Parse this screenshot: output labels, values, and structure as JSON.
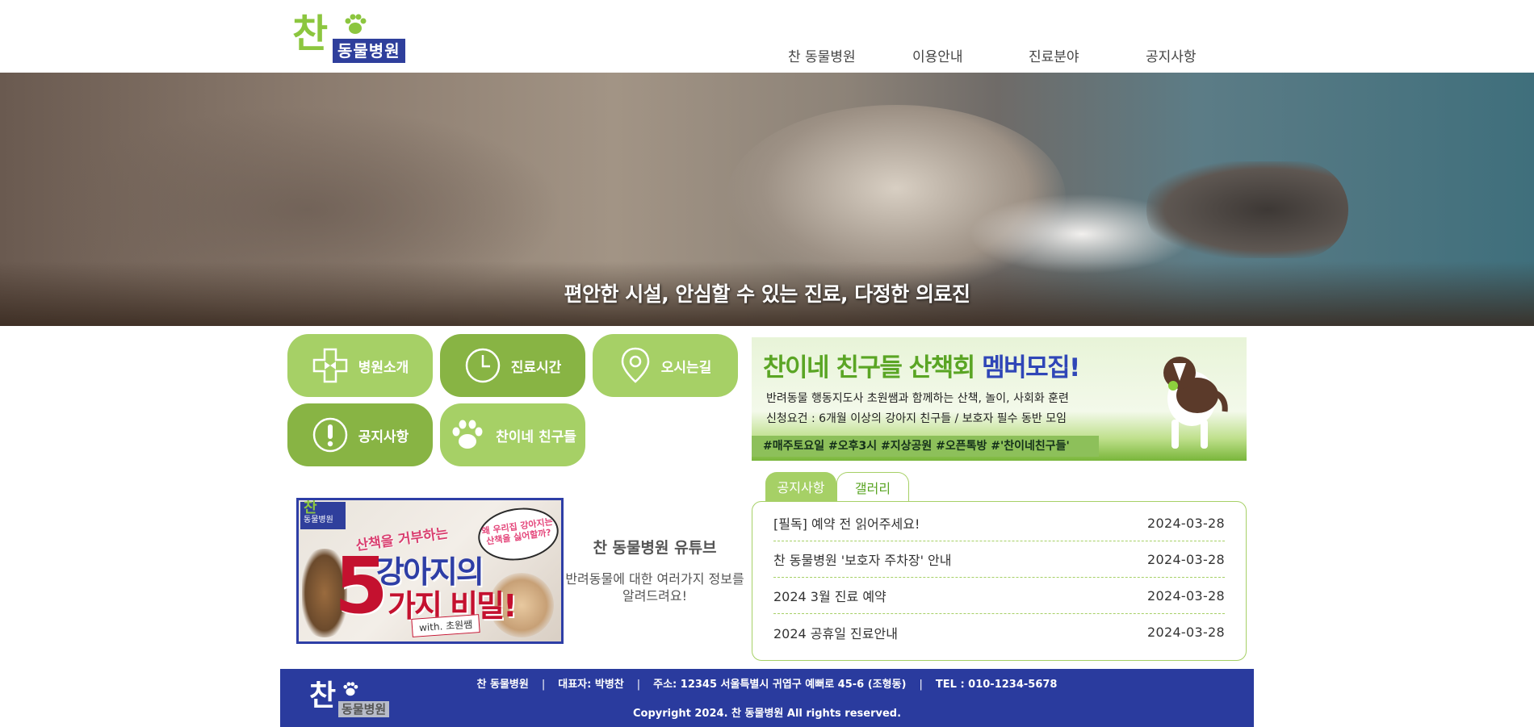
{
  "header": {
    "logo": {
      "main": "찬",
      "sub": "동물병원"
    },
    "nav": [
      "찬 동물병원",
      "이용안내",
      "진료분야",
      "공지사항"
    ]
  },
  "hero": {
    "text": "편안한 시설, 안심할 수 있는 진료, 다정한 의료진"
  },
  "quick_buttons": [
    {
      "label": "병원소개",
      "icon": "hospital-cross-icon"
    },
    {
      "label": "진료시간",
      "icon": "clock-icon"
    },
    {
      "label": "오시는길",
      "icon": "location-pin-icon"
    },
    {
      "label": "공지사항",
      "icon": "exclamation-icon"
    },
    {
      "label": "찬이네 친구들",
      "icon": "paw-icon"
    }
  ],
  "banner": {
    "title_green": "찬이네 친구들 산책회",
    "title_blue": "멤버모집!",
    "line1": "반려동물 행동지도사 초원쌤과 함께하는 산책, 놀이, 사회화 훈련",
    "line2": "신청요건 : 6개월 이상의 강아지 친구들 / 보호자 필수 동반 모임",
    "tags": "#매주토요일  #오후3시  #지상공원  #오픈톡방  #'찬이네친구들'"
  },
  "tabs": {
    "active": "공지사항",
    "inactive": "갤러리"
  },
  "notices": [
    {
      "title": "[필독] 예약 전 읽어주세요!",
      "date": "2024-03-28"
    },
    {
      "title": "찬 동물병원 '보호자 주차장' 안내",
      "date": "2024-03-28"
    },
    {
      "title": "2024 3월 진료 예약",
      "date": "2024-03-28"
    },
    {
      "title": "2024 공휴일 진료안내",
      "date": "2024-03-28"
    }
  ],
  "youtube": {
    "thumb": {
      "logo_main": "찬",
      "logo_sub": "동물병원",
      "bubble": "왜 우리집 강아지는 산책을 싫어할까?",
      "small": "산책을 거부하는",
      "big1": "강아지의",
      "five": "5",
      "big2": "가지 비밀!",
      "with": "with. 초원쌤"
    },
    "title": "찬 동물병원 유튜브",
    "desc": "반려동물에 대한 여러가지 정보를 알려드려요!"
  },
  "footer": {
    "logo": {
      "main": "찬",
      "sub": "동물병원"
    },
    "name": "찬 동물병원",
    "ceo": "대표자: 박병찬",
    "address": "주소: 12345 서울특별시 귀엽구 예뻐로 45-6 (조형동)",
    "tel": "TEL : 010-1234-5678",
    "copyright": "Copyright 2024. 찬 동물병원 All rights reserved."
  },
  "colors": {
    "accent_light": "#a6d066",
    "accent_dark": "#88b444",
    "brand_blue": "#2a3b9e"
  }
}
